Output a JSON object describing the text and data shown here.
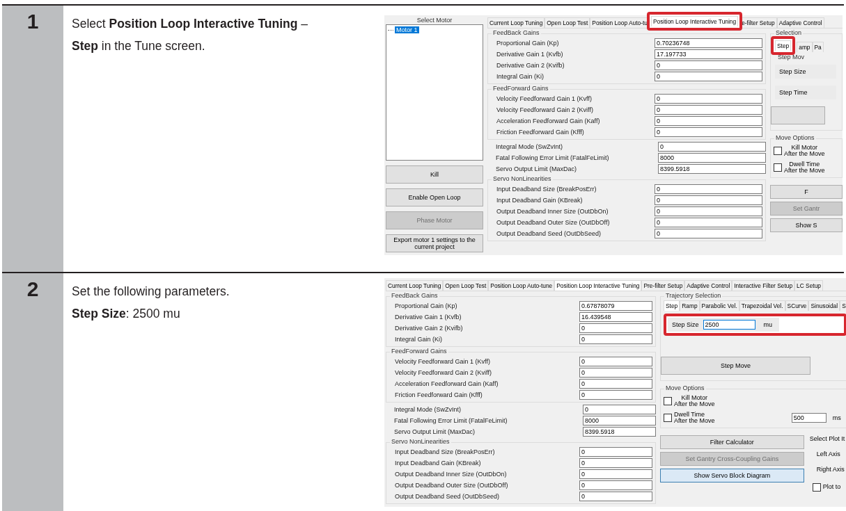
{
  "steps": [
    {
      "number": "1",
      "instruction": [
        "Select **Position Loop Interactive Tuning** – **Step** in the Tune screen."
      ],
      "screen": {
        "motor_panel": {
          "title": "Select Motor",
          "tree": [
            {
              "label": "Motor 1",
              "selected": true
            }
          ],
          "buttons": [
            {
              "label": "Kill",
              "disabled": false
            },
            {
              "label": "Enable Open Loop",
              "disabled": false
            },
            {
              "label": "Phase Motor",
              "disabled": true
            },
            {
              "label": "Export motor 1 settings to the current project",
              "disabled": false
            }
          ]
        },
        "tabs": [
          {
            "label": "Current Loop Tuning",
            "selected": false,
            "highlighted": false
          },
          {
            "label": "Open Loop Test",
            "selected": false,
            "highlighted": false
          },
          {
            "label": "Position Loop Auto-tu",
            "selected": false,
            "highlighted": false
          },
          {
            "label": "Position Loop Interactive Tuning",
            "selected": true,
            "highlighted": true
          },
          {
            "label": "e-filter Setup",
            "selected": false,
            "highlighted": false
          },
          {
            "label": "Adaptive Control",
            "selected": false,
            "highlighted": false
          }
        ],
        "gain_groups": [
          {
            "title": "FeedBack Gains",
            "rows": [
              {
                "label": "Proportional Gain (Kp)",
                "value": "0.70236748"
              },
              {
                "label": "Derivative Gain 1 (Kvfb)",
                "value": "17.197733"
              },
              {
                "label": "Derivative Gain 2 (Kvifb)",
                "value": "0"
              },
              {
                "label": "Integral Gain (Ki)",
                "value": "0"
              }
            ]
          },
          {
            "title": "FeedForward Gains",
            "rows": [
              {
                "label": "Velocity Feedforward Gain 1 (Kvff)",
                "value": "0"
              },
              {
                "label": "Velocity Feedforward Gain 2 (Kviff)",
                "value": "0"
              },
              {
                "label": "Acceleration Feedforward Gain (Kaff)",
                "value": "0"
              },
              {
                "label": "Friction Feedforward Gain (Kfff)",
                "value": "0"
              }
            ]
          },
          {
            "rows": [
              {
                "label": "Integral Mode (SwZvInt)",
                "value": "0"
              },
              {
                "label": "Fatal Following Error Limit (FatalFeLimit)",
                "value": "8000"
              },
              {
                "label": "Servo Output Limit (MaxDac)",
                "value": "8399.5918"
              }
            ]
          },
          {
            "title": "Servo NonLinearities",
            "rows": [
              {
                "label": "Input Deadband Size (BreakPosErr)",
                "value": "0"
              },
              {
                "label": "Input Deadband Gain (KBreak)",
                "value": "0"
              },
              {
                "label": "Output Deadband Inner Size (OutDbOn)",
                "value": "0"
              },
              {
                "label": "Output Deadband Outer Size (OutDbOff)",
                "value": "0"
              },
              {
                "label": "Output Deadband Seed (OutDbSeed)",
                "value": "0"
              }
            ]
          }
        ],
        "trajectory": {
          "title": "Selection",
          "tabs": [
            {
              "label": "Step",
              "selected": true,
              "highlighted": true
            },
            {
              "label": "amp",
              "selected": false,
              "highlighted": false
            },
            {
              "label": "Pa",
              "selected": false,
              "highlighted": false
            }
          ],
          "parameters_title": "Step Mov",
          "parameters": [
            {
              "label": "Step Size",
              "highlighted": false
            },
            {
              "label": "Step Time",
              "highlighted": false
            }
          ],
          "move_button": {
            "kind": "blank"
          }
        },
        "move_options": {
          "title": "Move Options",
          "checks": [
            {
              "label": "Kill Motor\nAfter the Move",
              "checked": false
            },
            {
              "label": "Dwell Time\nAfter the Move",
              "checked": false
            }
          ]
        },
        "buttons": [
          {
            "label": "F",
            "disabled": false,
            "focused": false
          },
          {
            "label": "Set Gantr",
            "disabled": true,
            "focused": false
          },
          {
            "label": "Show S",
            "disabled": false,
            "focused": false
          }
        ]
      }
    },
    {
      "number": "2",
      "instruction": [
        "Set the following parameters.",
        "**Step Size**: 2500 mu"
      ],
      "screen": {
        "tabs": [
          {
            "label": "Current Loop Tuning",
            "selected": false,
            "highlighted": false
          },
          {
            "label": "Open Loop Test",
            "selected": false,
            "highlighted": false
          },
          {
            "label": "Position Loop Auto-tune",
            "selected": false,
            "highlighted": false
          },
          {
            "label": "Position Loop Interactive Tuning",
            "selected": true,
            "highlighted": false
          },
          {
            "label": "Pre-filter Setup",
            "selected": false,
            "highlighted": false
          },
          {
            "label": "Adaptive Control",
            "selected": false,
            "highlighted": false
          },
          {
            "label": "Interactive Filter Setup",
            "selected": false,
            "highlighted": false
          },
          {
            "label": "LC Setup",
            "selected": false,
            "highlighted": false
          }
        ],
        "gain_groups": [
          {
            "title": "FeedBack Gains",
            "rows": [
              {
                "label": "Proportional Gain (Kp)",
                "value": "0.67878079"
              },
              {
                "label": "Derivative Gain 1 (Kvfb)",
                "value": "16.439548"
              },
              {
                "label": "Derivative Gain 2 (Kvifb)",
                "value": "0"
              },
              {
                "label": "Integral Gain (Ki)",
                "value": "0"
              }
            ]
          },
          {
            "title": "FeedForward Gains",
            "rows": [
              {
                "label": "Velocity Feedforward Gain 1 (Kvff)",
                "value": "0"
              },
              {
                "label": "Velocity Feedforward Gain 2 (Kviff)",
                "value": "0"
              },
              {
                "label": "Acceleration Feedforward Gain (Kaff)",
                "value": "0"
              },
              {
                "label": "Friction Feedforward Gain (Kfff)",
                "value": "0"
              }
            ]
          },
          {
            "rows": [
              {
                "label": "Integral Mode (SwZvInt)",
                "value": "0"
              },
              {
                "label": "Fatal Following Error Limit (FatalFeLimit)",
                "value": "8000"
              },
              {
                "label": "Servo Output Limit (MaxDac)",
                "value": "8399.5918"
              }
            ]
          },
          {
            "title": "Servo NonLinearities",
            "rows": [
              {
                "label": "Input Deadband Size (BreakPosErr)",
                "value": "0"
              },
              {
                "label": "Input Deadband Gain (KBreak)",
                "value": "0"
              },
              {
                "label": "Output Deadband Inner Size (OutDbOn)",
                "value": "0"
              },
              {
                "label": "Output Deadband Outer Size (OutDbOff)",
                "value": "0"
              },
              {
                "label": "Output Deadband Seed (OutDbSeed)",
                "value": "0"
              }
            ]
          }
        ],
        "trajectory": {
          "title": "Trajectory Selection",
          "tabs": [
            {
              "label": "Step",
              "selected": true,
              "highlighted": false
            },
            {
              "label": "Ramp",
              "selected": false,
              "highlighted": false
            },
            {
              "label": "Parabolic Vel.",
              "selected": false,
              "highlighted": false
            },
            {
              "label": "Trapezoidal Vel.",
              "selected": false,
              "highlighted": false
            },
            {
              "label": "SCurve",
              "selected": false,
              "highlighted": false
            },
            {
              "label": "Sinusoidal",
              "selected": false,
              "highlighted": false
            },
            {
              "label": "S",
              "selected": false,
              "highlighted": false
            }
          ],
          "parameters": [
            {
              "label": "Step Size",
              "value": "2500",
              "unit": "mu",
              "focused": true,
              "highlighted": true
            }
          ],
          "move_button": {
            "kind": "labeled",
            "label": "Step Move"
          }
        },
        "move_options": {
          "title": "Move Options",
          "checks": [
            {
              "label": "Kill Motor\nAfter the Move",
              "checked": false
            },
            {
              "label": "Dwell Time\nAfter the Move",
              "checked": false,
              "value": "500",
              "unit": "ms"
            }
          ]
        },
        "buttons": [
          {
            "label": "Filter Calculator",
            "disabled": false,
            "focused": false
          },
          {
            "label": "Set Gantry Cross-Coupling Gains",
            "disabled": true,
            "focused": false
          },
          {
            "label": "Show Servo Block Diagram",
            "disabled": false,
            "focused": true
          }
        ],
        "plot_panel": {
          "title": "Select Plot It",
          "axes": [
            "Left Axis",
            "Right Axis"
          ],
          "check": {
            "label": "Plot to",
            "checked": false
          }
        }
      }
    }
  ]
}
